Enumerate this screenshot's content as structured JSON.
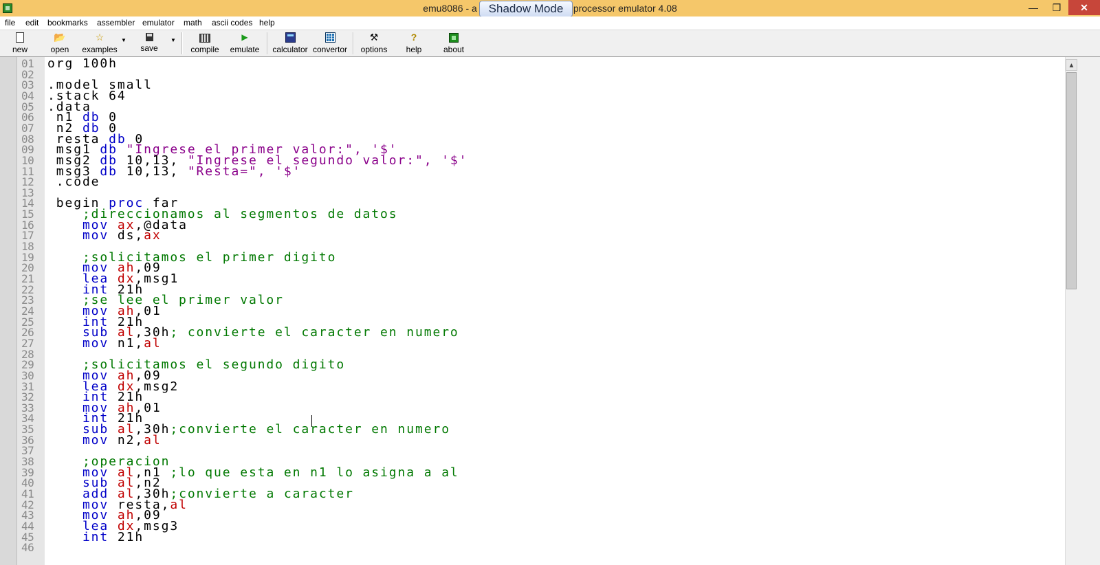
{
  "window": {
    "title_left": "emu8086 - a",
    "title_right": "processor emulator 4.08",
    "shadow_mode": "Shadow Mode",
    "minimize_glyph": "—",
    "maximize_glyph": "❒",
    "close_glyph": "✕"
  },
  "menu": [
    "file",
    "edit",
    "bookmarks",
    "assembler",
    "emulator",
    "math",
    "ascii codes",
    "help"
  ],
  "toolbar": {
    "new": "new",
    "open": "open",
    "examples": "examples",
    "save": "save",
    "compile": "compile",
    "emulate": "emulate",
    "calculator": "calculator",
    "convertor": "convertor",
    "options": "options",
    "help": "help",
    "about": "about",
    "dropdown_arrow": "▼",
    "icons": {
      "open": "📂",
      "examples": "☆",
      "emulate": "▶",
      "options": "⚒",
      "help": "?"
    }
  },
  "editor": {
    "line_numbers": [
      "01",
      "02",
      "03",
      "04",
      "05",
      "06",
      "07",
      "08",
      "09",
      "10",
      "11",
      "12",
      "13",
      "14",
      "15",
      "16",
      "17",
      "18",
      "19",
      "20",
      "21",
      "22",
      "23",
      "24",
      "25",
      "26",
      "27",
      "28",
      "29",
      "30",
      "31",
      "32",
      "33",
      "34",
      "35",
      "36",
      "37",
      "38",
      "39",
      "40",
      "41",
      "42",
      "43",
      "44",
      "45",
      "46"
    ],
    "lines": [
      [
        [
          "dir",
          "org 100h"
        ]
      ],
      [],
      [
        [
          "dir",
          ".model small"
        ]
      ],
      [
        [
          "dir",
          ".stack 64"
        ]
      ],
      [
        [
          "dir",
          ".data"
        ]
      ],
      [
        [
          "dir",
          " n1 "
        ],
        [
          "kw",
          "db"
        ],
        [
          "dir",
          " 0"
        ]
      ],
      [
        [
          "dir",
          " n2 "
        ],
        [
          "kw",
          "db"
        ],
        [
          "dir",
          " 0"
        ]
      ],
      [
        [
          "dir",
          " resta "
        ],
        [
          "kw",
          "db"
        ],
        [
          "dir",
          " 0"
        ]
      ],
      [
        [
          "dir",
          " msg1 "
        ],
        [
          "kw",
          "db"
        ],
        [
          "dir",
          " "
        ],
        [
          "str",
          "\"Ingrese el primer valor:\", '$'"
        ]
      ],
      [
        [
          "dir",
          " msg2 "
        ],
        [
          "kw",
          "db"
        ],
        [
          "dir",
          " 10,13, "
        ],
        [
          "str",
          "\"Ingrese el segundo valor:\", '$'"
        ]
      ],
      [
        [
          "dir",
          " msg3 "
        ],
        [
          "kw",
          "db"
        ],
        [
          "dir",
          " 10,13, "
        ],
        [
          "str",
          "\"Resta=\", '$'"
        ]
      ],
      [
        [
          "dir",
          " .code"
        ]
      ],
      [],
      [
        [
          "dir",
          " begin "
        ],
        [
          "kw",
          "proc"
        ],
        [
          "dir",
          " far"
        ]
      ],
      [
        [
          "cmt",
          "    ;direccionamos al segmentos de datos"
        ]
      ],
      [
        [
          "kw",
          "    mov "
        ],
        [
          "reg",
          "ax"
        ],
        [
          "dir",
          ",@data"
        ]
      ],
      [
        [
          "kw",
          "    mov "
        ],
        [
          "dir",
          "ds,"
        ],
        [
          "reg",
          "ax"
        ]
      ],
      [],
      [
        [
          "cmt",
          "    ;solicitamos el primer digito"
        ]
      ],
      [
        [
          "kw",
          "    mov "
        ],
        [
          "reg",
          "ah"
        ],
        [
          "dir",
          ",09"
        ]
      ],
      [
        [
          "kw",
          "    lea "
        ],
        [
          "reg",
          "dx"
        ],
        [
          "dir",
          ",msg1"
        ]
      ],
      [
        [
          "kw",
          "    int "
        ],
        [
          "dir",
          "21h"
        ]
      ],
      [
        [
          "cmt",
          "    ;se lee el primer valor"
        ]
      ],
      [
        [
          "kw",
          "    mov "
        ],
        [
          "reg",
          "ah"
        ],
        [
          "dir",
          ",01"
        ]
      ],
      [
        [
          "kw",
          "    int "
        ],
        [
          "dir",
          "21h"
        ]
      ],
      [
        [
          "kw",
          "    sub "
        ],
        [
          "reg",
          "al"
        ],
        [
          "dir",
          ",30h"
        ],
        [
          "cmt",
          "; convierte el caracter en numero"
        ]
      ],
      [
        [
          "kw",
          "    mov "
        ],
        [
          "dir",
          "n1,"
        ],
        [
          "reg",
          "al"
        ]
      ],
      [],
      [
        [
          "cmt",
          "    ;solicitamos el segundo digito"
        ]
      ],
      [
        [
          "kw",
          "    mov "
        ],
        [
          "reg",
          "ah"
        ],
        [
          "dir",
          ",09"
        ]
      ],
      [
        [
          "kw",
          "    lea "
        ],
        [
          "reg",
          "dx"
        ],
        [
          "dir",
          ",msg2"
        ]
      ],
      [
        [
          "kw",
          "    int "
        ],
        [
          "dir",
          "21h"
        ]
      ],
      [
        [
          "kw",
          "    mov "
        ],
        [
          "reg",
          "ah"
        ],
        [
          "dir",
          ",01"
        ]
      ],
      [
        [
          "kw",
          "    int "
        ],
        [
          "dir",
          "21h"
        ]
      ],
      [
        [
          "kw",
          "    sub "
        ],
        [
          "reg",
          "al"
        ],
        [
          "dir",
          ",30h"
        ],
        [
          "cmt",
          ";convierte el caracter en numero"
        ]
      ],
      [
        [
          "kw",
          "    mov "
        ],
        [
          "dir",
          "n2,"
        ],
        [
          "reg",
          "al"
        ]
      ],
      [],
      [
        [
          "cmt",
          "    ;operacion"
        ]
      ],
      [
        [
          "kw",
          "    mov "
        ],
        [
          "reg",
          "al"
        ],
        [
          "dir",
          ",n1 "
        ],
        [
          "cmt",
          ";lo que esta en n1 lo asigna a al"
        ]
      ],
      [
        [
          "kw",
          "    sub "
        ],
        [
          "reg",
          "al"
        ],
        [
          "dir",
          ",n2"
        ]
      ],
      [
        [
          "kw",
          "    add "
        ],
        [
          "reg",
          "al"
        ],
        [
          "dir",
          ",30h"
        ],
        [
          "cmt",
          ";convierte a caracter"
        ]
      ],
      [
        [
          "kw",
          "    mov "
        ],
        [
          "dir",
          "resta,"
        ],
        [
          "reg",
          "al"
        ]
      ],
      [
        [
          "kw",
          "    mov "
        ],
        [
          "reg",
          "ah"
        ],
        [
          "dir",
          ",09"
        ]
      ],
      [
        [
          "kw",
          "    lea "
        ],
        [
          "reg",
          "dx"
        ],
        [
          "dir",
          ",msg3"
        ]
      ],
      [
        [
          "kw",
          "    int "
        ],
        [
          "dir",
          "21h"
        ]
      ],
      []
    ]
  },
  "scrollbar": {
    "up_glyph": "▲"
  }
}
